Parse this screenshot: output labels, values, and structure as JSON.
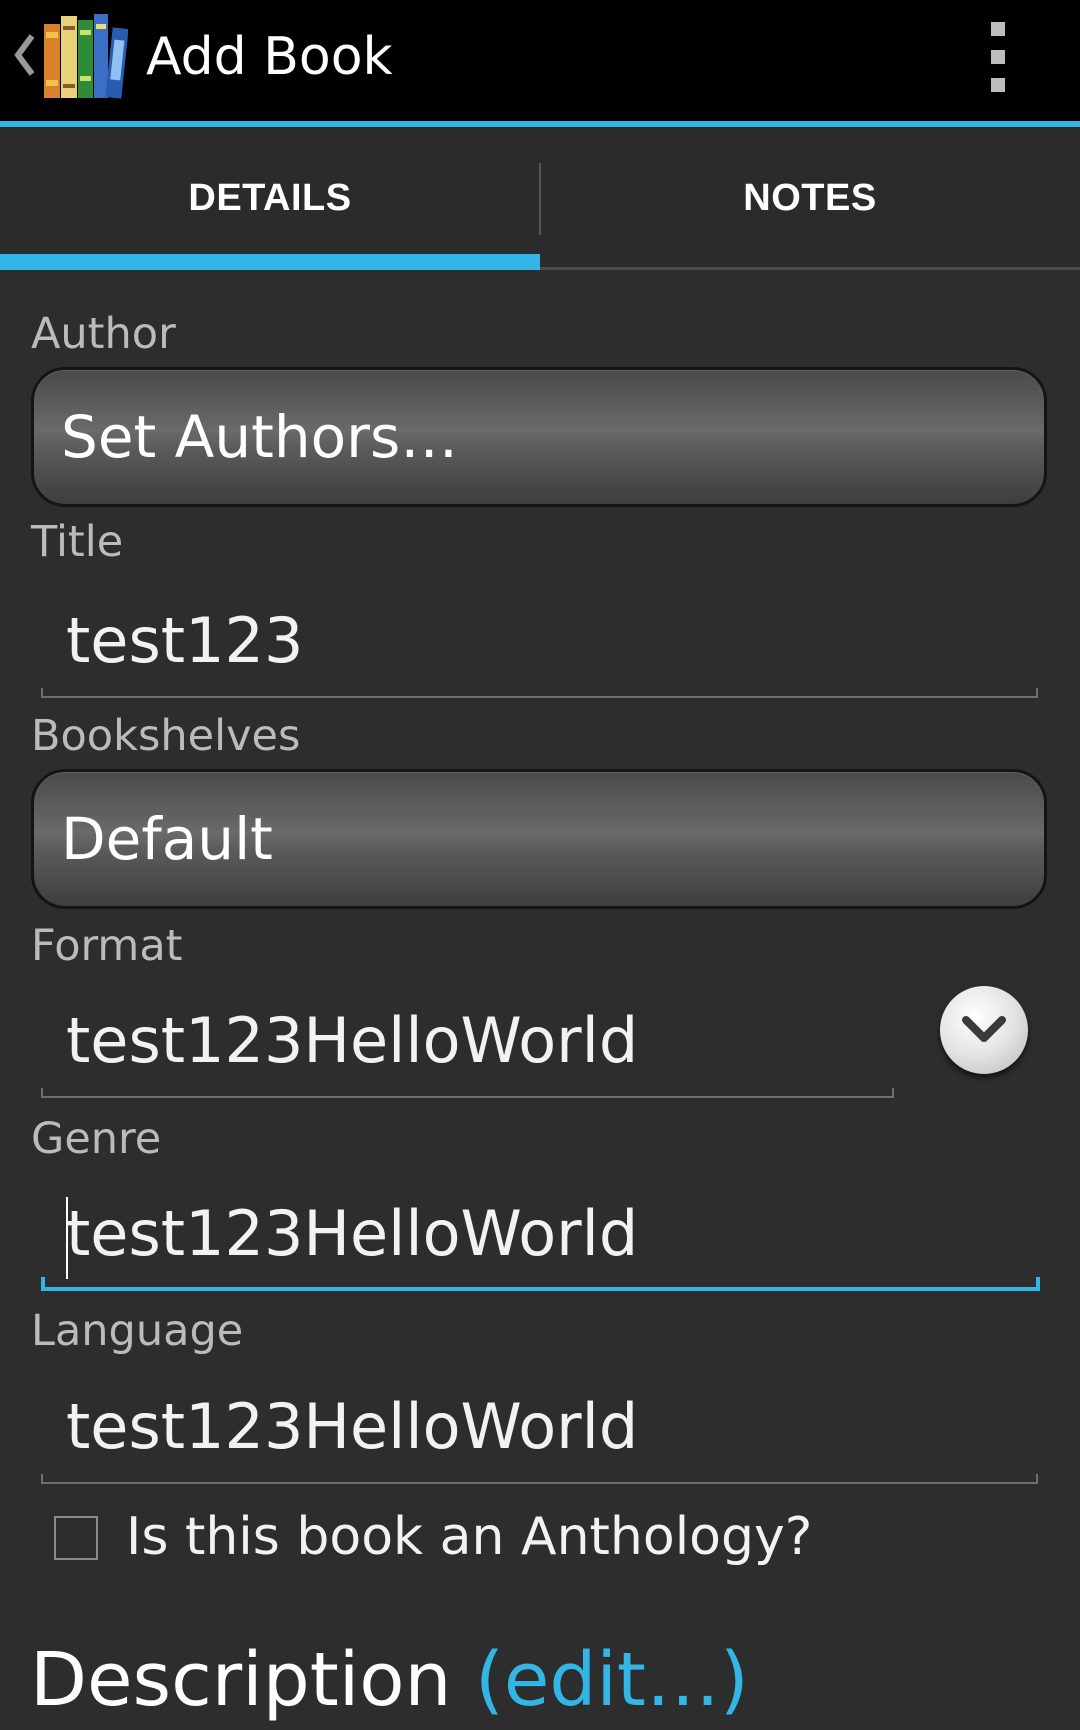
{
  "actionbar": {
    "title": "Add Book",
    "up_icon": "chevron-left-icon",
    "app_icon": "books-icon",
    "overflow_icon": "more-vert-icon"
  },
  "tabs": [
    {
      "label": "DETAILS",
      "selected": true
    },
    {
      "label": "NOTES",
      "selected": false
    }
  ],
  "form": {
    "author": {
      "label": "Author",
      "button": "Set Authors…"
    },
    "title": {
      "label": "Title",
      "value": "test123"
    },
    "bookshelves": {
      "label": "Bookshelves",
      "button": "Default"
    },
    "format": {
      "label": "Format",
      "value": "test123HelloWorld",
      "dropdown_icon": "chevron-down-icon"
    },
    "genre": {
      "label": "Genre",
      "value": "test123HelloWorld",
      "focused": true
    },
    "language": {
      "label": "Language",
      "value": "test123HelloWorld"
    },
    "anthology": {
      "label": "Is this book an Anthology?",
      "checked": false
    },
    "description": {
      "label": "Description ",
      "edit_link": "(edit…)"
    }
  },
  "colors": {
    "accent": "#33b5e5",
    "background": "#2d2d2d",
    "actionbar": "#000000"
  }
}
